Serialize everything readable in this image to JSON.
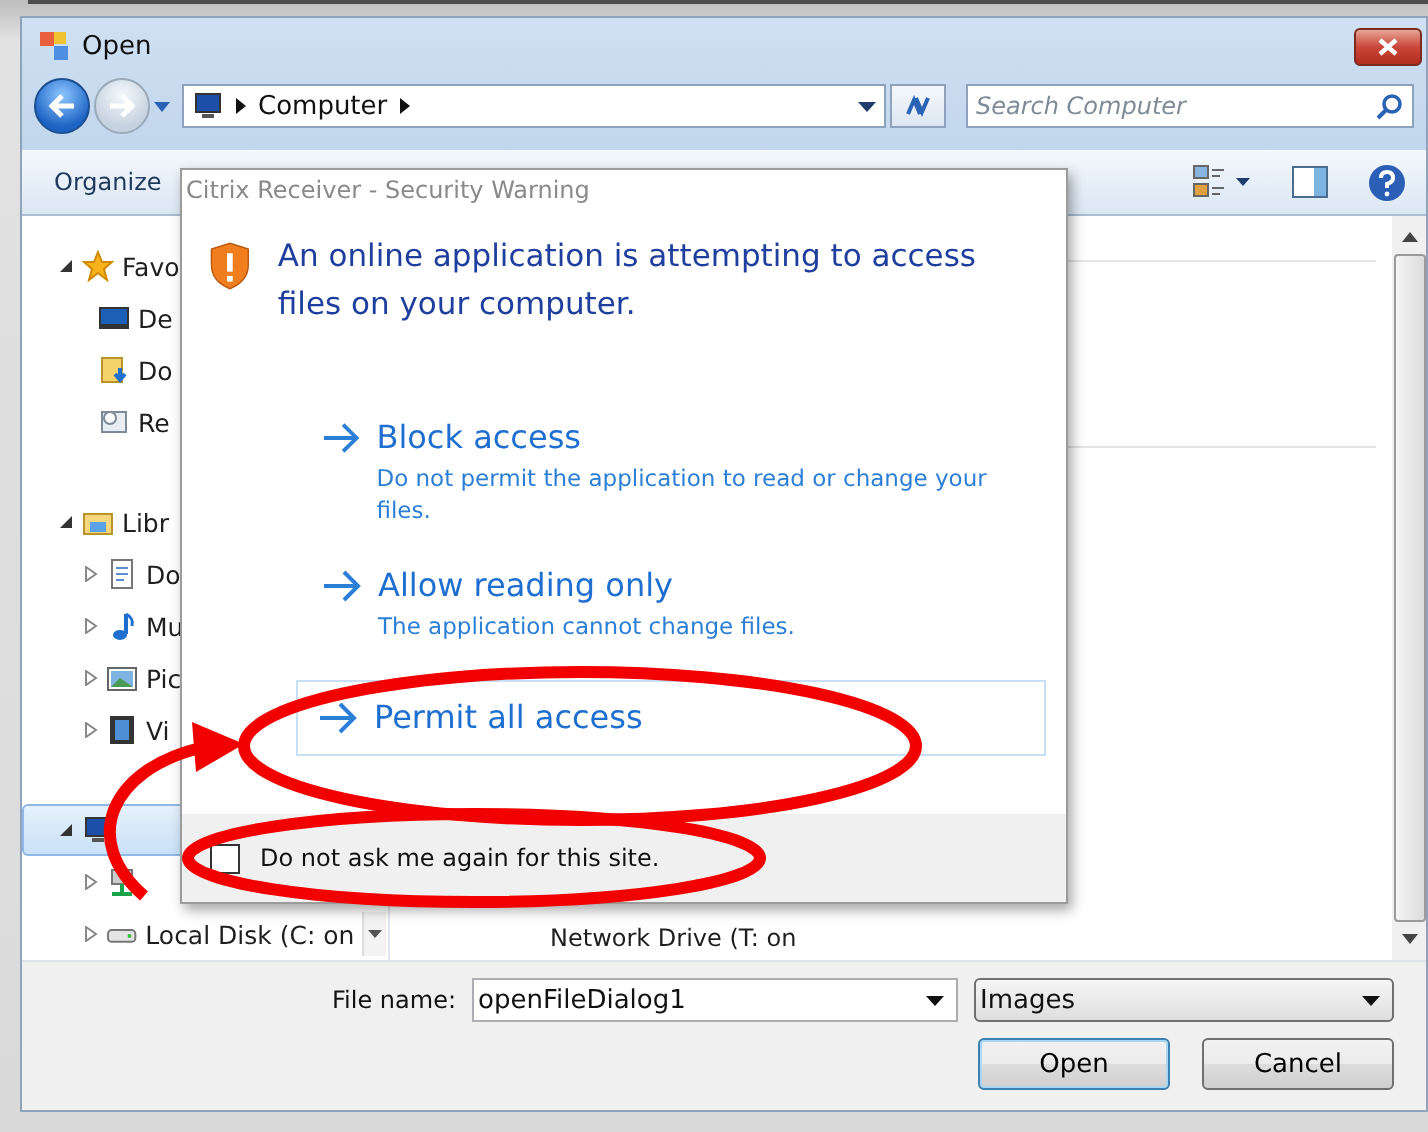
{
  "window": {
    "title": "Open"
  },
  "address": {
    "crumbs": [
      "Computer"
    ]
  },
  "search": {
    "placeholder": "Search Computer"
  },
  "toolbar": {
    "organize": "Organize"
  },
  "sidebar": {
    "groups": [
      {
        "label": "Favo",
        "kind": "star",
        "expanded": true,
        "selected": false,
        "children": [
          {
            "label": "De",
            "kind": "desktop",
            "selected": false
          },
          {
            "label": "Do",
            "kind": "downloads",
            "selected": false
          },
          {
            "label": "Re",
            "kind": "recent",
            "selected": false
          }
        ]
      },
      {
        "label": "Libr",
        "kind": "library",
        "expanded": true,
        "selected": false,
        "children": [
          {
            "label": "Do",
            "kind": "document",
            "expanded": false,
            "selected": false
          },
          {
            "label": "Mu",
            "kind": "music",
            "expanded": false,
            "selected": false
          },
          {
            "label": "Pic",
            "kind": "pictures",
            "expanded": false,
            "selected": false
          },
          {
            "label": "Vi",
            "kind": "video",
            "expanded": false,
            "selected": false
          }
        ]
      },
      {
        "kind": "computer",
        "expanded": true,
        "selected": true,
        "children": [
          {
            "kind": "network",
            "expanded": false,
            "selected": false
          },
          {
            "label": "Local Disk (C: on",
            "kind": "disk",
            "expanded": false,
            "selected": false
          }
        ]
      }
    ]
  },
  "content": {
    "items": [
      {
        "label": "Network Drive (T: on"
      }
    ]
  },
  "footer": {
    "file_name_label": "File name:",
    "file_name": "openFileDialog1",
    "filter": "Images",
    "buttons": [
      {
        "label": "Open",
        "default": true
      },
      {
        "label": "Cancel",
        "default": false
      }
    ]
  },
  "security_dialog": {
    "title": "Citrix Receiver - Security Warning",
    "heading": "An online application is attempting to access files on your computer.",
    "options": [
      {
        "title": "Block access",
        "description": "Do not permit the application to read or change your files.",
        "selected": false
      },
      {
        "title": "Allow reading only",
        "description": "The application cannot change files.",
        "selected": false
      },
      {
        "title": "Permit all access",
        "selected": true
      }
    ],
    "checkbox": {
      "label": "Do not ask me again for this site.",
      "checked": false
    }
  }
}
